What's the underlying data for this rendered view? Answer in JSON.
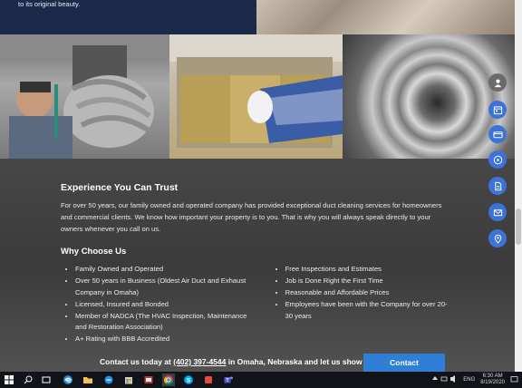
{
  "hero": {
    "text": "to its original beauty."
  },
  "section": {
    "title": "Experience You Can Trust",
    "paragraph": "For over 50 years, our family owned and operated company has provided exceptional duct cleaning services for homeowners and commercial clients. We know how important your property is to you. That is why you will always speak directly to your owners whenever you call on us.",
    "why_title": "Why Choose Us",
    "list_left": [
      "Family Owned and Operated",
      "Over 50 years in Business (Oldest Air Duct and Exhaust Company in Omaha)",
      "Licensed, Insured and Bonded",
      "Member of NADCA (The HVAC Inspection, Maintenance and Restoration Association)",
      "A+ Rating with BBB Accredited"
    ],
    "list_right": [
      "Free Inspections and Estimates",
      "Job is Done Right the First Time",
      "Reasonable and Affordable Prices",
      "Employees have been with the Company for over 20-30 years"
    ]
  },
  "contact_bar": {
    "prefix": "Contact us today at ",
    "phone": "(402) 397-4544",
    "suffix": " in Omaha, Nebraska and let us show off our cleani",
    "button": "Contact"
  },
  "side_buttons": [
    "user-icon",
    "calendar-icon",
    "credit-card-icon",
    "play-icon",
    "document-icon",
    "email-icon",
    "location-icon"
  ],
  "taskbar": {
    "language": "ENG",
    "time": "6:30 AM",
    "date": "8/19/2020"
  },
  "colors": {
    "accent": "#3b73d9",
    "hero_bg": "#1b2a4a",
    "contact_button": "#2f7fd6"
  }
}
